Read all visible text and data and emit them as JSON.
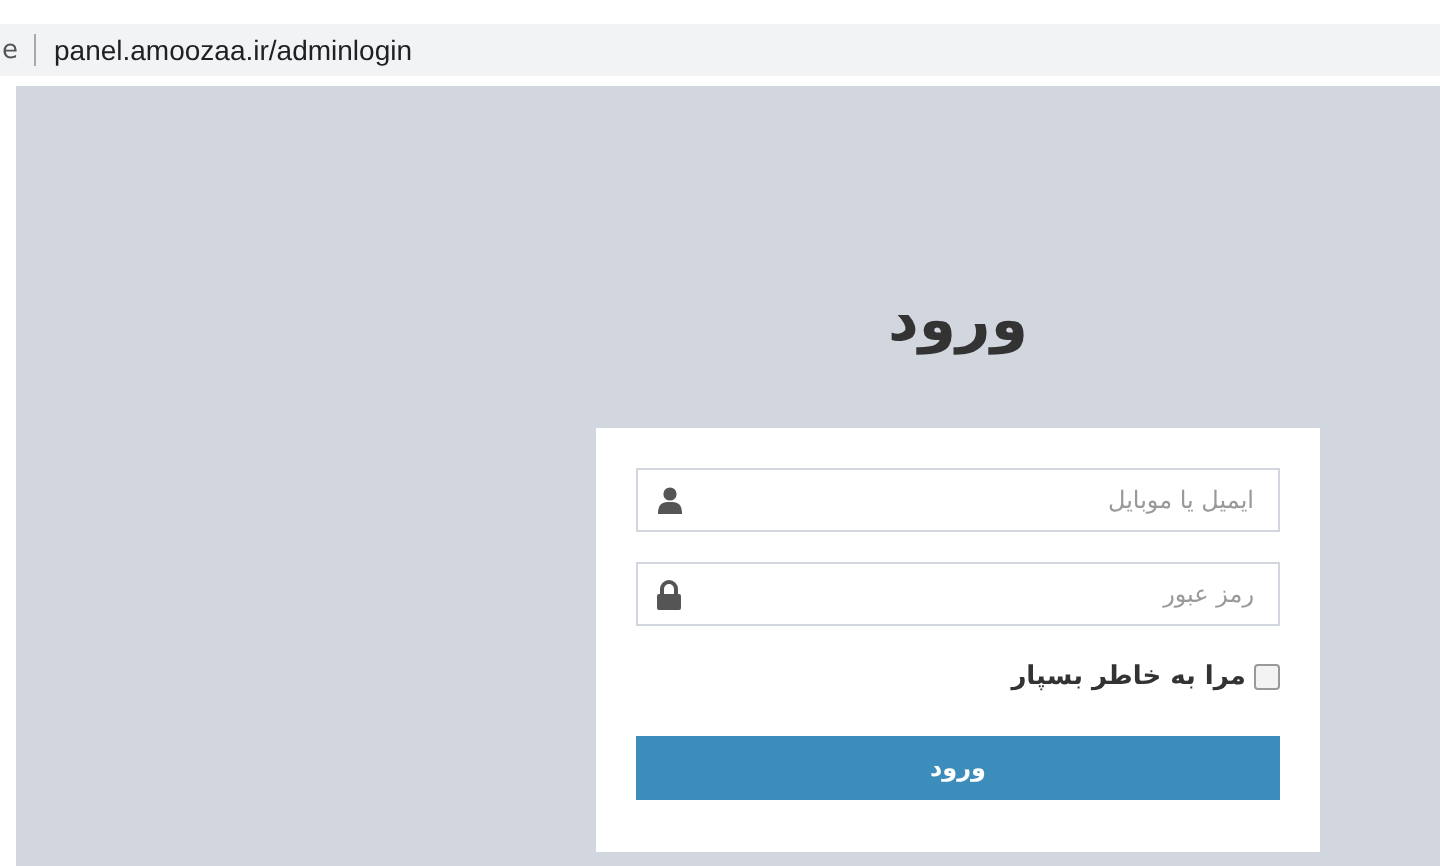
{
  "address_bar": {
    "tab_fragment": "e",
    "url": "panel.amoozaa.ir/adminlogin"
  },
  "login": {
    "title": "ورود",
    "fields": [
      {
        "kind": "user",
        "placeholder": "ایمیل یا موبایل"
      },
      {
        "kind": "lock",
        "placeholder": "رمز عبور"
      }
    ],
    "remember": {
      "label": "مرا به خاطر بسپار",
      "checked": false
    },
    "submit": "ورود"
  }
}
